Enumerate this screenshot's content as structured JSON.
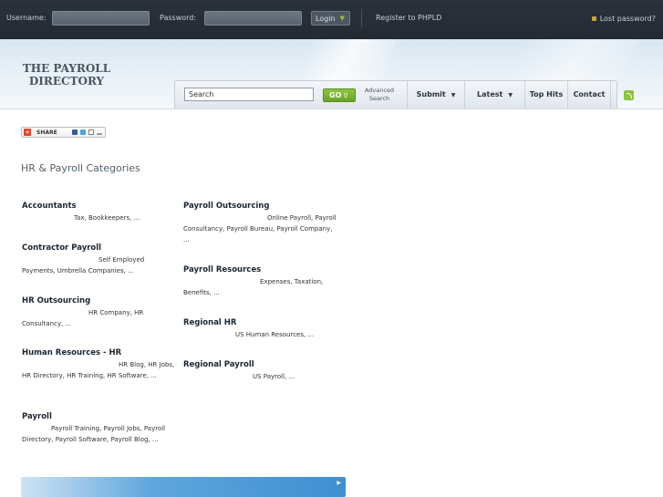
{
  "topbar": {
    "username_label": "Username:",
    "password_label": "Password:",
    "login_label": "Login",
    "register_label": "Register to PHPLD",
    "lost_password_label": "Lost password?"
  },
  "header": {
    "logo_line1": "THE PAYROLL",
    "logo_line2": "DIRECTORY"
  },
  "nav": {
    "search_value": "Search",
    "go_label": "GO",
    "advanced_line1": "Advanced",
    "advanced_line2": "Search",
    "items": [
      {
        "label": "Submit",
        "dropdown": true
      },
      {
        "label": "Latest",
        "dropdown": true
      },
      {
        "label": "Top Hits",
        "dropdown": false
      },
      {
        "label": "Contact",
        "dropdown": false
      }
    ]
  },
  "share": {
    "label": "SHARE"
  },
  "categories_heading": "HR & Payroll Categories",
  "categories_left": [
    {
      "title": "Accountants",
      "subs": "Tax, Bookkeepers, ..."
    },
    {
      "title": "Contractor Payroll",
      "subs": "Self Employed Payments, Umbrella Companies, ..."
    },
    {
      "title": "HR Outsourcing",
      "subs": "HR Company, HR Consultancy, ..."
    },
    {
      "title": "Human Resources - HR",
      "subs": "HR Blog, HR Jobs, HR Directory, HR Training, HR Software, ..."
    },
    {
      "title": "Payroll",
      "subs": "Payroll Training, Payroll Jobs, Payroll Directory, Payroll Software, Payroll Blog, ..."
    }
  ],
  "categories_right": [
    {
      "title": "Payroll Outsourcing",
      "subs": "Online Payroll, Payroll Consultancy, Payroll Bureau, Payroll Company, ..."
    },
    {
      "title": "Payroll Resources",
      "subs": "Expenses, Taxation, Benefits, ..."
    },
    {
      "title": "Regional HR",
      "subs": "US Human Resources, ..."
    },
    {
      "title": "Regional Payroll",
      "subs": "US Payroll, ..."
    }
  ],
  "colors": {
    "accent_green": "#8dc63f",
    "topbar": "#2b323b",
    "link_text": "#1c2630"
  }
}
